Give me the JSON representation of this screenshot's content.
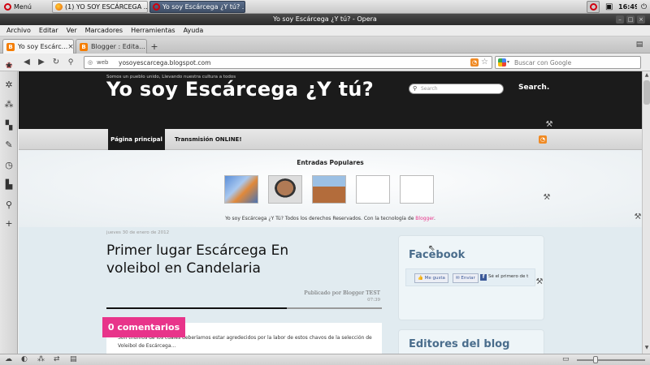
{
  "taskbar": {
    "menu_label": "Menú",
    "tasks": [
      {
        "label": "(1) YO SOY ESCÁRCEGA ..."
      },
      {
        "label": "Yo soy Escárcega ¿Y tú? ..."
      }
    ],
    "clock": "16:49"
  },
  "window": {
    "title": "Yo soy Escárcega ¿Y tú? - Opera"
  },
  "menubar": [
    "Archivo",
    "Editar",
    "Ver",
    "Marcadores",
    "Herramientas",
    "Ayuda"
  ],
  "tabs": [
    {
      "label": "Yo soy Escárc..."
    },
    {
      "label": "Blogger : Edita..."
    }
  ],
  "address": {
    "web_label": "web",
    "url": "yosoyescarcega.blogspot.com",
    "search_placeholder": "Buscar con Google"
  },
  "blog": {
    "description": "Somos un pueblo unido, Llevando nuestra cultura a todos",
    "title": "Yo soy Escárcega ¿Y tú?",
    "search_placeholder": "Search",
    "search_button": "Search.",
    "nav": [
      "Página principal",
      "Transmisión ONLINE!"
    ],
    "popular_heading": "Entradas Populares",
    "footer_text": "Yo soy Escárcega ¿Y Tú? Todos los derechos Reservados. Con la tecnología de ",
    "footer_link": "Blogger",
    "footer_end": "."
  },
  "post": {
    "date": "jueves 30 de enero de 2012",
    "title": "Primer lugar Escárcega En voleibol en Candelaria",
    "byline": "Publicado por Blogger TEST",
    "time": "07:39",
    "comments": "0 comentarios",
    "excerpt": "Son triunfos de los cuales deberíamos estar agredecidos por la labor de estos chavos de la selección de",
    "excerpt2": "Voleibol de Escárcega..."
  },
  "sidebar": {
    "facebook_title": "Facebook",
    "fb_like": "Me gusta",
    "fb_send": "Enviar",
    "fb_text": "Sé el primero de t",
    "editors_title": "Editores del blog"
  },
  "colors": {
    "accent_pink": "#e8348a",
    "header_black": "#1b1b1b",
    "opera_red": "#d1000f"
  }
}
